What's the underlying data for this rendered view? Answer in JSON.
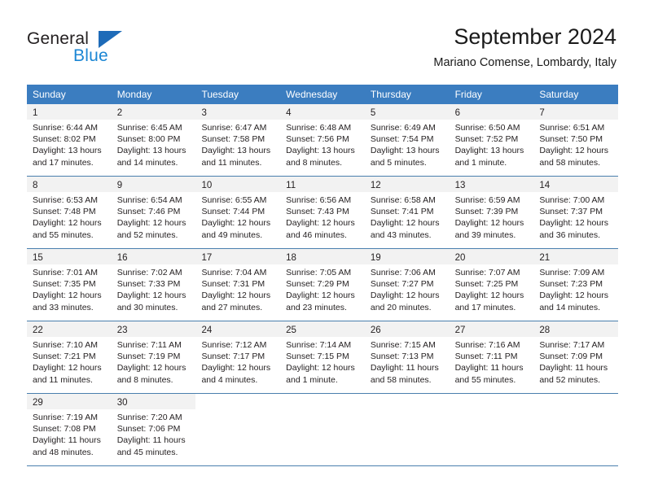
{
  "brand": {
    "name_part1": "General",
    "name_part2": "Blue",
    "triangle_icon": "triangle-icon",
    "colors": {
      "dark": "#231f20",
      "blue": "#1b86d4",
      "triangle": "#1e6bb8"
    }
  },
  "header": {
    "title": "September 2024",
    "subtitle": "Mariano Comense, Lombardy, Italy"
  },
  "colors": {
    "header_row_bg": "#3b7dc0",
    "header_row_text": "#ffffff",
    "daynum_bg": "#f2f2f2",
    "separator": "#4a7fae",
    "text": "#231f20"
  },
  "calendar": {
    "weekdays": [
      "Sunday",
      "Monday",
      "Tuesday",
      "Wednesday",
      "Thursday",
      "Friday",
      "Saturday"
    ],
    "weeks": [
      [
        {
          "day": "1",
          "sunrise": "Sunrise: 6:44 AM",
          "sunset": "Sunset: 8:02 PM",
          "daylight": "Daylight: 13 hours and 17 minutes."
        },
        {
          "day": "2",
          "sunrise": "Sunrise: 6:45 AM",
          "sunset": "Sunset: 8:00 PM",
          "daylight": "Daylight: 13 hours and 14 minutes."
        },
        {
          "day": "3",
          "sunrise": "Sunrise: 6:47 AM",
          "sunset": "Sunset: 7:58 PM",
          "daylight": "Daylight: 13 hours and 11 minutes."
        },
        {
          "day": "4",
          "sunrise": "Sunrise: 6:48 AM",
          "sunset": "Sunset: 7:56 PM",
          "daylight": "Daylight: 13 hours and 8 minutes."
        },
        {
          "day": "5",
          "sunrise": "Sunrise: 6:49 AM",
          "sunset": "Sunset: 7:54 PM",
          "daylight": "Daylight: 13 hours and 5 minutes."
        },
        {
          "day": "6",
          "sunrise": "Sunrise: 6:50 AM",
          "sunset": "Sunset: 7:52 PM",
          "daylight": "Daylight: 13 hours and 1 minute."
        },
        {
          "day": "7",
          "sunrise": "Sunrise: 6:51 AM",
          "sunset": "Sunset: 7:50 PM",
          "daylight": "Daylight: 12 hours and 58 minutes."
        }
      ],
      [
        {
          "day": "8",
          "sunrise": "Sunrise: 6:53 AM",
          "sunset": "Sunset: 7:48 PM",
          "daylight": "Daylight: 12 hours and 55 minutes."
        },
        {
          "day": "9",
          "sunrise": "Sunrise: 6:54 AM",
          "sunset": "Sunset: 7:46 PM",
          "daylight": "Daylight: 12 hours and 52 minutes."
        },
        {
          "day": "10",
          "sunrise": "Sunrise: 6:55 AM",
          "sunset": "Sunset: 7:44 PM",
          "daylight": "Daylight: 12 hours and 49 minutes."
        },
        {
          "day": "11",
          "sunrise": "Sunrise: 6:56 AM",
          "sunset": "Sunset: 7:43 PM",
          "daylight": "Daylight: 12 hours and 46 minutes."
        },
        {
          "day": "12",
          "sunrise": "Sunrise: 6:58 AM",
          "sunset": "Sunset: 7:41 PM",
          "daylight": "Daylight: 12 hours and 43 minutes."
        },
        {
          "day": "13",
          "sunrise": "Sunrise: 6:59 AM",
          "sunset": "Sunset: 7:39 PM",
          "daylight": "Daylight: 12 hours and 39 minutes."
        },
        {
          "day": "14",
          "sunrise": "Sunrise: 7:00 AM",
          "sunset": "Sunset: 7:37 PM",
          "daylight": "Daylight: 12 hours and 36 minutes."
        }
      ],
      [
        {
          "day": "15",
          "sunrise": "Sunrise: 7:01 AM",
          "sunset": "Sunset: 7:35 PM",
          "daylight": "Daylight: 12 hours and 33 minutes."
        },
        {
          "day": "16",
          "sunrise": "Sunrise: 7:02 AM",
          "sunset": "Sunset: 7:33 PM",
          "daylight": "Daylight: 12 hours and 30 minutes."
        },
        {
          "day": "17",
          "sunrise": "Sunrise: 7:04 AM",
          "sunset": "Sunset: 7:31 PM",
          "daylight": "Daylight: 12 hours and 27 minutes."
        },
        {
          "day": "18",
          "sunrise": "Sunrise: 7:05 AM",
          "sunset": "Sunset: 7:29 PM",
          "daylight": "Daylight: 12 hours and 23 minutes."
        },
        {
          "day": "19",
          "sunrise": "Sunrise: 7:06 AM",
          "sunset": "Sunset: 7:27 PM",
          "daylight": "Daylight: 12 hours and 20 minutes."
        },
        {
          "day": "20",
          "sunrise": "Sunrise: 7:07 AM",
          "sunset": "Sunset: 7:25 PM",
          "daylight": "Daylight: 12 hours and 17 minutes."
        },
        {
          "day": "21",
          "sunrise": "Sunrise: 7:09 AM",
          "sunset": "Sunset: 7:23 PM",
          "daylight": "Daylight: 12 hours and 14 minutes."
        }
      ],
      [
        {
          "day": "22",
          "sunrise": "Sunrise: 7:10 AM",
          "sunset": "Sunset: 7:21 PM",
          "daylight": "Daylight: 12 hours and 11 minutes."
        },
        {
          "day": "23",
          "sunrise": "Sunrise: 7:11 AM",
          "sunset": "Sunset: 7:19 PM",
          "daylight": "Daylight: 12 hours and 8 minutes."
        },
        {
          "day": "24",
          "sunrise": "Sunrise: 7:12 AM",
          "sunset": "Sunset: 7:17 PM",
          "daylight": "Daylight: 12 hours and 4 minutes."
        },
        {
          "day": "25",
          "sunrise": "Sunrise: 7:14 AM",
          "sunset": "Sunset: 7:15 PM",
          "daylight": "Daylight: 12 hours and 1 minute."
        },
        {
          "day": "26",
          "sunrise": "Sunrise: 7:15 AM",
          "sunset": "Sunset: 7:13 PM",
          "daylight": "Daylight: 11 hours and 58 minutes."
        },
        {
          "day": "27",
          "sunrise": "Sunrise: 7:16 AM",
          "sunset": "Sunset: 7:11 PM",
          "daylight": "Daylight: 11 hours and 55 minutes."
        },
        {
          "day": "28",
          "sunrise": "Sunrise: 7:17 AM",
          "sunset": "Sunset: 7:09 PM",
          "daylight": "Daylight: 11 hours and 52 minutes."
        }
      ],
      [
        {
          "day": "29",
          "sunrise": "Sunrise: 7:19 AM",
          "sunset": "Sunset: 7:08 PM",
          "daylight": "Daylight: 11 hours and 48 minutes."
        },
        {
          "day": "30",
          "sunrise": "Sunrise: 7:20 AM",
          "sunset": "Sunset: 7:06 PM",
          "daylight": "Daylight: 11 hours and 45 minutes."
        },
        {
          "day": "",
          "sunrise": "",
          "sunset": "",
          "daylight": ""
        },
        {
          "day": "",
          "sunrise": "",
          "sunset": "",
          "daylight": ""
        },
        {
          "day": "",
          "sunrise": "",
          "sunset": "",
          "daylight": ""
        },
        {
          "day": "",
          "sunrise": "",
          "sunset": "",
          "daylight": ""
        },
        {
          "day": "",
          "sunrise": "",
          "sunset": "",
          "daylight": ""
        }
      ]
    ]
  }
}
